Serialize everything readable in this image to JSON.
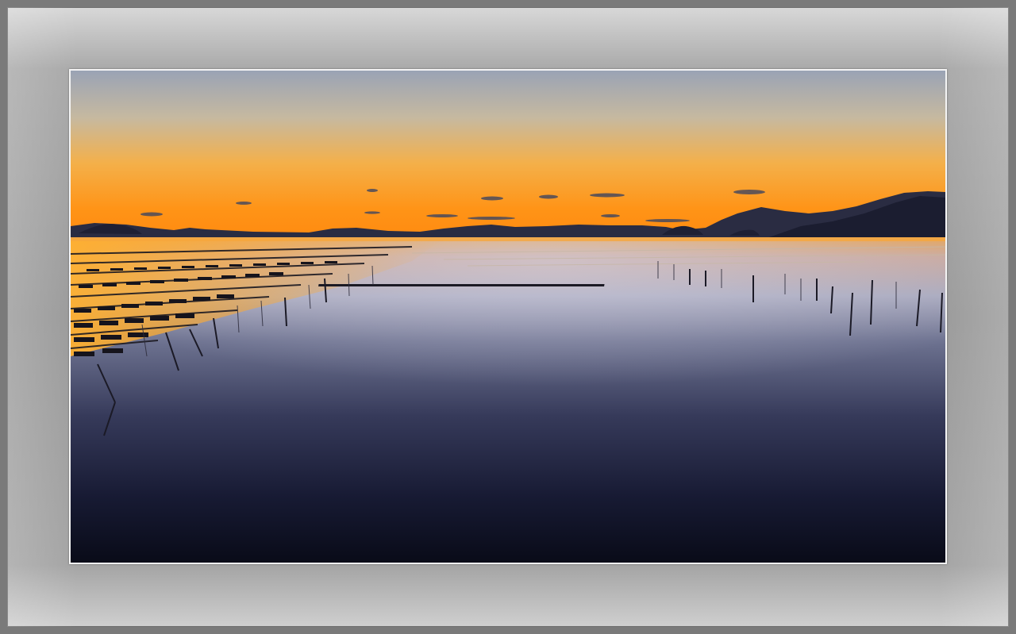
{
  "image": {
    "subject": "photo",
    "colors": {
      "frame_dark": "#7a7a7a",
      "mat_light": "#d8d8d8",
      "sky_top": "#9ea6b6",
      "sky_horizon": "#ff9a1e",
      "water_glow": "#f0a23a",
      "water_deep": "#0c1020",
      "silhouette": "#1a1d2e"
    }
  }
}
